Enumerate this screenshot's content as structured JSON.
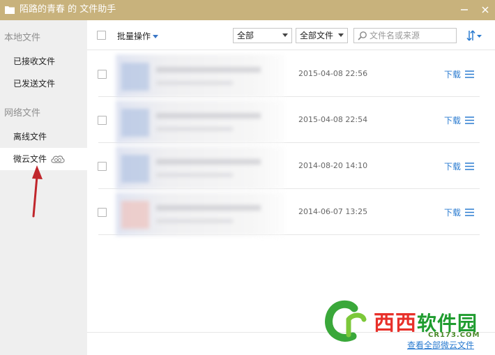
{
  "window": {
    "title": "陌路的青春 的 文件助手",
    "minimize_symbol": "—",
    "close_symbol": "✕",
    "titlebar_color": "#c8b27c"
  },
  "sidebar": {
    "local_section": "本地文件",
    "local_items": [
      {
        "label": "已接收文件"
      },
      {
        "label": "已发送文件"
      }
    ],
    "network_section": "网络文件",
    "network_items": [
      {
        "label": "离线文件",
        "active": false
      },
      {
        "label": "微云文件",
        "active": true,
        "icon": "weiyun-cloud-icon"
      }
    ]
  },
  "toolbar": {
    "batch_label": "批量操作",
    "filter_scope": "全部",
    "filter_type": "全部文件",
    "search_placeholder": "文件名或来源",
    "sort_icon": "sort-arrows-icon"
  },
  "files": [
    {
      "date": "2015-04-08 22:56",
      "action": "下载",
      "thumb_hue": "blue"
    },
    {
      "date": "2015-04-08 22:54",
      "action": "下载",
      "thumb_hue": "blue"
    },
    {
      "date": "2014-08-20 14:10",
      "action": "下载",
      "thumb_hue": "blue"
    },
    {
      "date": "2014-06-07 13:25",
      "action": "下载",
      "thumb_hue": "red"
    }
  ],
  "footer": {
    "view_all_label": "查看全部微云文件"
  },
  "watermark": {
    "text_main": "西西",
    "text_second": "软件园",
    "url": "CR173.COM"
  },
  "colors": {
    "link": "#2a7bd0",
    "arrow": "#c0262c"
  }
}
